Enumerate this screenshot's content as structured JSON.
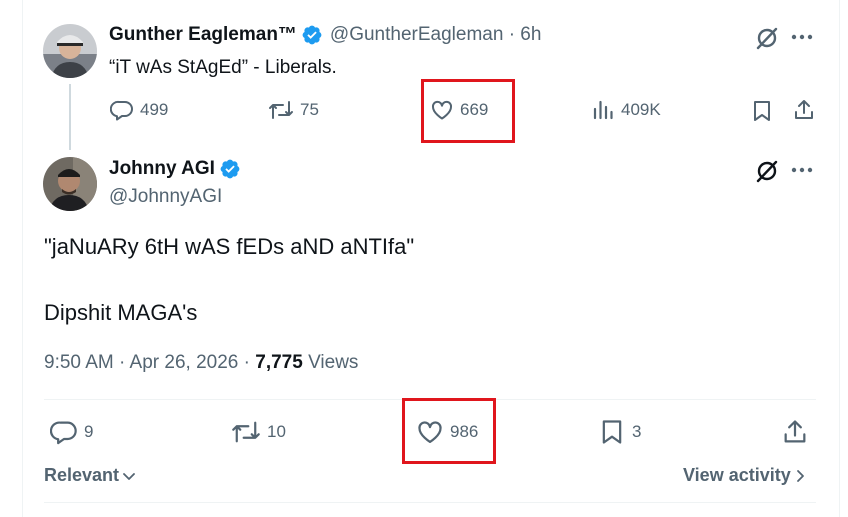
{
  "parent_tweet": {
    "display_name": "Gunther Eagleman™",
    "handle_time": "@GuntherEagleman · 6h",
    "text": "“iT wAs StAgEd” - Liberals.",
    "replies": "499",
    "reposts": "75",
    "likes": "669",
    "views": "409K"
  },
  "main_tweet": {
    "display_name": "Johnny AGI",
    "handle": "@JohnnyAGI",
    "line1": "\"jaNuARy 6tH wAS fEDs aND aNTIfa\"",
    "line2": "Dipshit MAGA's",
    "timestamp": "9:50 AM · Apr 26, 2026 · ",
    "views_count": "7,775",
    "views_label": " Views",
    "replies": "9",
    "reposts": "10",
    "likes": "986",
    "bookmarks": "3"
  },
  "footer": {
    "sort_label": "Relevant",
    "view_activity": "View activity"
  },
  "colors": {
    "verified": "#1d9bf0",
    "highlight": "#e0161d",
    "muted": "#536471"
  }
}
